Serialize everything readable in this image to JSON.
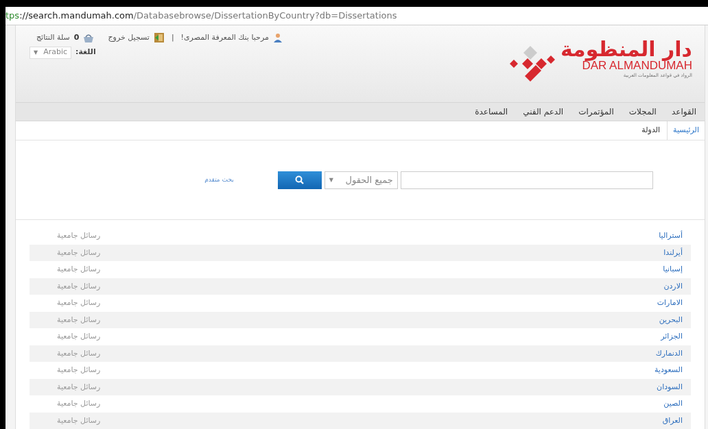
{
  "address_bar": {
    "scheme": "tps",
    "host": "://search.mandumah.com",
    "path": "/Databasebrowse/DissertationByCountry?db=Dissertations"
  },
  "header": {
    "welcome": "مرحبا بنك المعرفة المصرى!",
    "separator": "|",
    "logout": "تسجيل خروج",
    "cart_count": "0",
    "cart_label": "سلة النتائج",
    "language_label": "اللغة:",
    "language_value": "Arabic",
    "language_caret": "▼"
  },
  "logo": {
    "arabic": "دار المنظومة",
    "latin": "DAR ALMANDUMAH",
    "tagline": "الرواد في قواعد المعلومات العربية"
  },
  "nav": [
    {
      "label": "القواعد"
    },
    {
      "label": "المجلات"
    },
    {
      "label": "المؤتمرات"
    },
    {
      "label": "الدعم الفني"
    },
    {
      "label": "المساعدة"
    }
  ],
  "breadcrumb": [
    {
      "label": "الرئيسية",
      "kind": "link"
    },
    {
      "label": "الدولة",
      "kind": "current"
    }
  ],
  "search": {
    "field_select": "جميع الحقول",
    "field_caret": "▼",
    "advanced": "بحث متقدم"
  },
  "countries": [
    {
      "name": "أستراليا",
      "type": "رسائل جامعية"
    },
    {
      "name": "أيرلندا",
      "type": "رسائل جامعية"
    },
    {
      "name": "إسبانيا",
      "type": "رسائل جامعية"
    },
    {
      "name": "الاردن",
      "type": "رسائل جامعية"
    },
    {
      "name": "الامارات",
      "type": "رسائل جامعية"
    },
    {
      "name": "البحرين",
      "type": "رسائل جامعية"
    },
    {
      "name": "الجزائر",
      "type": "رسائل جامعية"
    },
    {
      "name": "الدنمارك",
      "type": "رسائل جامعية"
    },
    {
      "name": "السعودية",
      "type": "رسائل جامعية"
    },
    {
      "name": "السودان",
      "type": "رسائل جامعية"
    },
    {
      "name": "الصين",
      "type": "رسائل جامعية"
    },
    {
      "name": "العراق",
      "type": "رسائل جامعية"
    }
  ]
}
